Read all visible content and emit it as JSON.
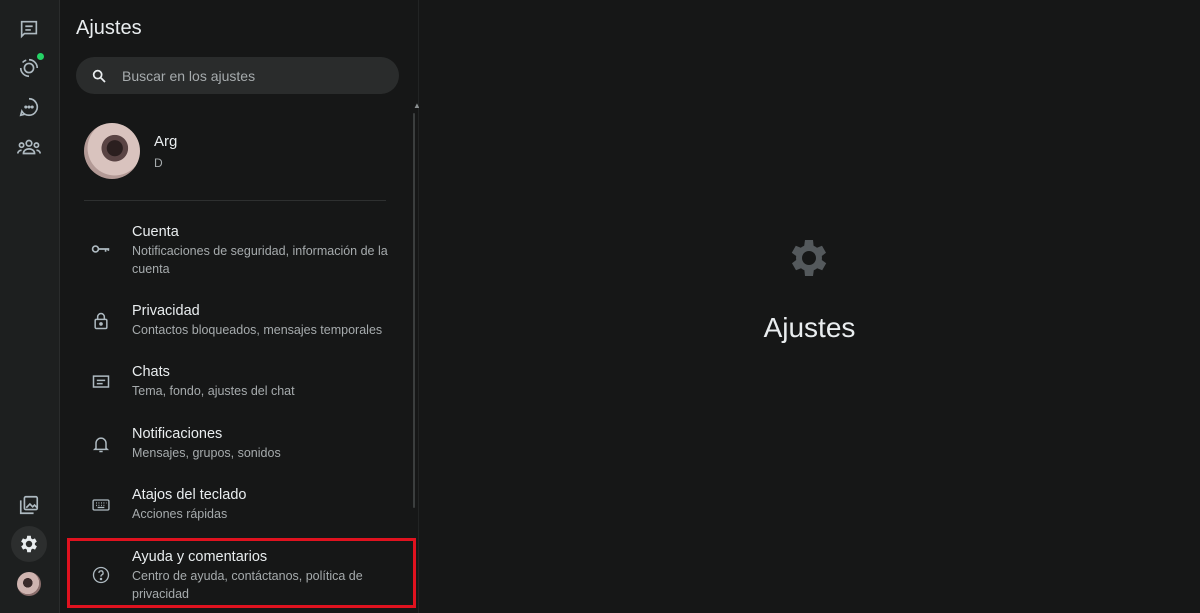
{
  "rail": {
    "icons": [
      "chats-icon",
      "status-icon",
      "channels-icon",
      "communities-icon",
      "media-icon",
      "settings-icon",
      "profile-avatar"
    ],
    "status_dot_color": "#25d366"
  },
  "panel": {
    "title": "Ajustes",
    "search_placeholder": "Buscar en los ajustes",
    "profile": {
      "name": "Arg",
      "status": "D"
    },
    "items": [
      {
        "title": "Cuenta",
        "subtitle": "Notificaciones de seguridad, información de la cuenta",
        "icon": "key-icon"
      },
      {
        "title": "Privacidad",
        "subtitle": "Contactos bloqueados, mensajes temporales",
        "icon": "lock-icon"
      },
      {
        "title": "Chats",
        "subtitle": "Tema, fondo, ajustes del chat",
        "icon": "chat-icon"
      },
      {
        "title": "Notificaciones",
        "subtitle": "Mensajes, grupos, sonidos",
        "icon": "bell-icon"
      },
      {
        "title": "Atajos del teclado",
        "subtitle": "Acciones rápidas",
        "icon": "keyboard-icon"
      },
      {
        "title": "Ayuda y comentarios",
        "subtitle": "Centro de ayuda, contáctanos, política de privacidad",
        "icon": "help-icon"
      }
    ]
  },
  "highlight_color": "#e0121f",
  "main": {
    "title": "Ajustes",
    "icon": "gear-icon"
  }
}
